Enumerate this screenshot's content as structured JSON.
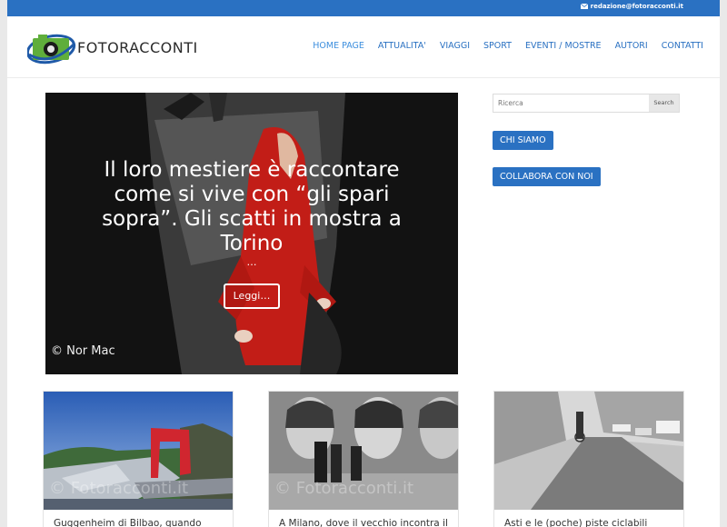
{
  "topbar": {
    "email": "redazione@fotoracconti.it"
  },
  "header": {
    "logo_text": "FOTORACCONTI",
    "nav": [
      "HOME PAGE",
      "ATTUALITA'",
      "VIAGGI",
      "SPORT",
      "EVENTI / MOSTRE",
      "AUTORI",
      "CONTATTI"
    ]
  },
  "hero": {
    "title": "Il loro mestiere è raccontare come si vive con “gli spari sopra”. Gli scatti in mostra a Torino",
    "ellipsis": "…",
    "button": "Leggi…",
    "credit": "© Nor Mac"
  },
  "sidebar": {
    "search_placeholder": "Ricerca",
    "search_button": "Search",
    "btn_chi_siamo": "CHI SIAMO",
    "btn_collabora": "COLLABORA CON NOI"
  },
  "cards": [
    {
      "title": "Guggenheim di Bilbao, quando",
      "watermark": "© Fotoracconti.it"
    },
    {
      "title": "A Milano, dove il vecchio incontra il",
      "watermark": "© Fotoracconti.it"
    },
    {
      "title": "Asti e le (poche) piste ciclabili",
      "watermark": ""
    }
  ],
  "colors": {
    "brand_blue": "#2a71c2",
    "nav_active": "#3d8fde"
  }
}
